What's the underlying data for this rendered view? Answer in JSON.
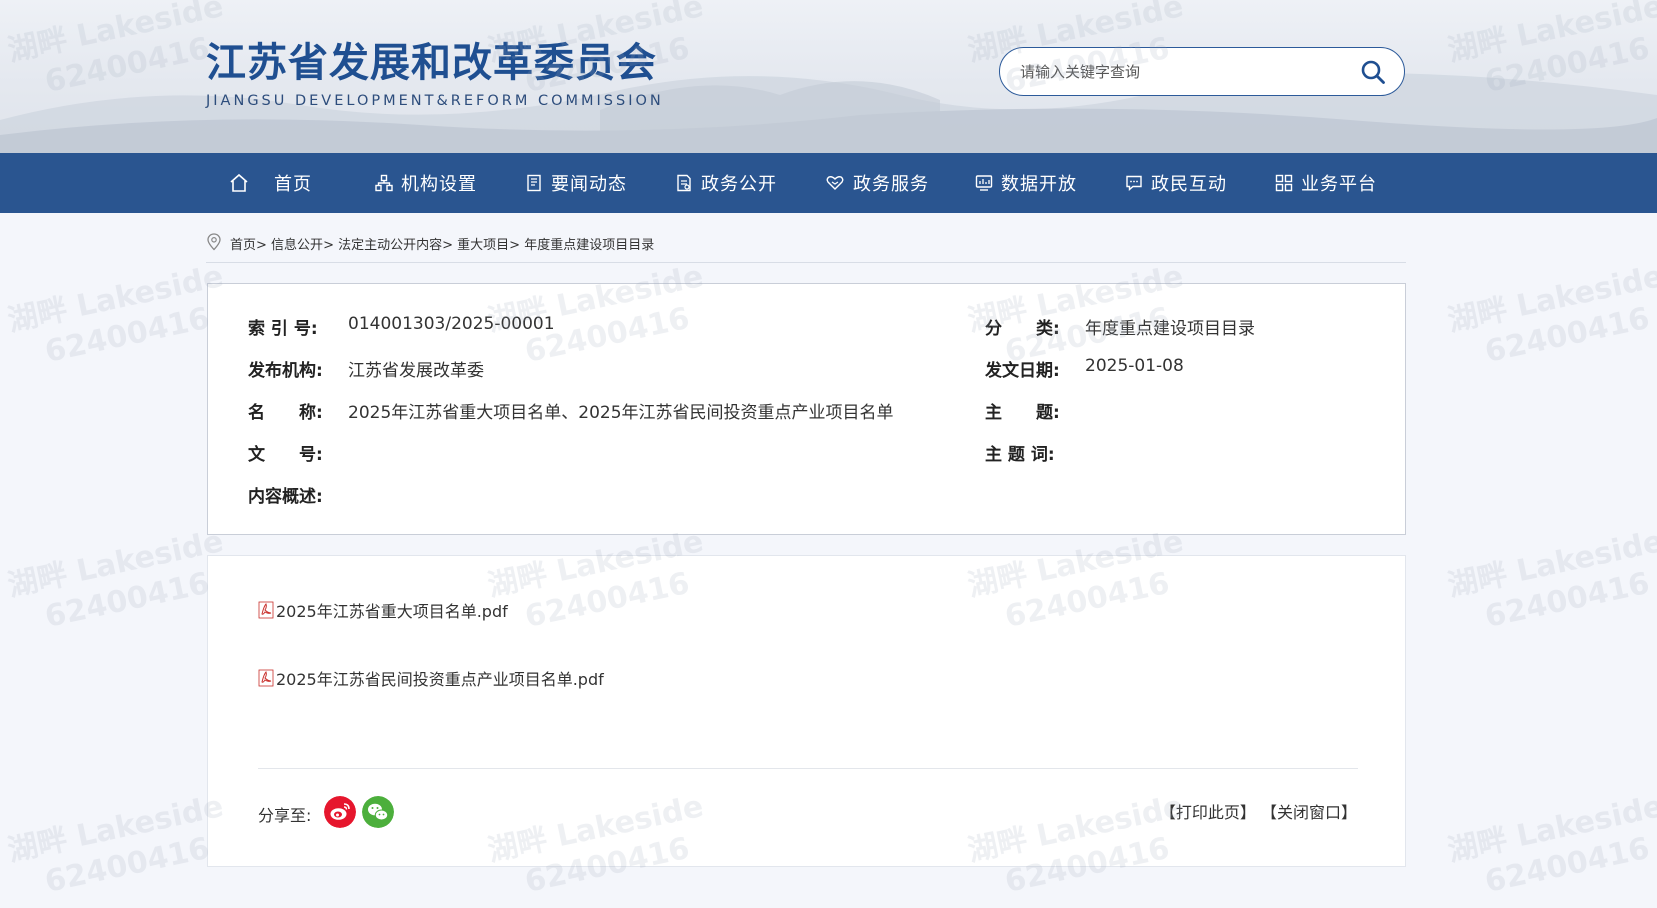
{
  "header": {
    "title": "江苏省发展和改革委员会",
    "subtitle": "JIANGSU DEVELOPMENT&REFORM COMMISSION",
    "search_placeholder": "请输入关键字查询"
  },
  "nav": {
    "items": [
      {
        "label": "首页",
        "icon": "home-icon"
      },
      {
        "label": "机构设置",
        "icon": "org-chart-icon"
      },
      {
        "label": "要闻动态",
        "icon": "news-icon"
      },
      {
        "label": "政务公开",
        "icon": "document-icon"
      },
      {
        "label": "政务服务",
        "icon": "service-icon"
      },
      {
        "label": "数据开放",
        "icon": "data-icon"
      },
      {
        "label": "政民互动",
        "icon": "chat-icon"
      },
      {
        "label": "业务平台",
        "icon": "grid-icon"
      }
    ]
  },
  "breadcrumb": [
    "首页",
    "信息公开",
    "法定主动公开内容",
    "重大项目",
    "年度重点建设项目目录"
  ],
  "meta": {
    "index_label": "索 引 号:",
    "index_value": "014001303/2025-00001",
    "category_label": "分　　类:",
    "category_value": "年度重点建设项目目录",
    "publisher_label": "发布机构:",
    "publisher_value": "江苏省发展改革委",
    "date_label": "发文日期:",
    "date_value": "2025-01-08",
    "name_label": "名　　称:",
    "name_value": "2025年江苏省重大项目名单、2025年江苏省民间投资重点产业项目名单",
    "subject_label": "主　　题:",
    "subject_value": "",
    "docno_label": "文　　号:",
    "docno_value": "",
    "keywords_label": "主 题 词:",
    "keywords_value": "",
    "summary_label": "内容概述:",
    "summary_value": ""
  },
  "attachments": [
    {
      "name": "2025年江苏省重大项目名单.pdf",
      "icon": "pdf-icon"
    },
    {
      "name": "2025年江苏省民间投资重点产业项目名单.pdf",
      "icon": "pdf-icon"
    }
  ],
  "footer": {
    "share_label": "分享至:",
    "share": [
      {
        "icon": "weibo-icon",
        "color": "#e6162d"
      },
      {
        "icon": "wechat-icon",
        "color": "#4caf3c"
      }
    ],
    "print_label": "【打印此页】",
    "close_label": "【关闭窗口】"
  },
  "watermark": {
    "line1": "湖畔 Lakeside",
    "line2": "62400416"
  },
  "colors": {
    "brand": "#2a5590",
    "title": "#1f4f91"
  }
}
